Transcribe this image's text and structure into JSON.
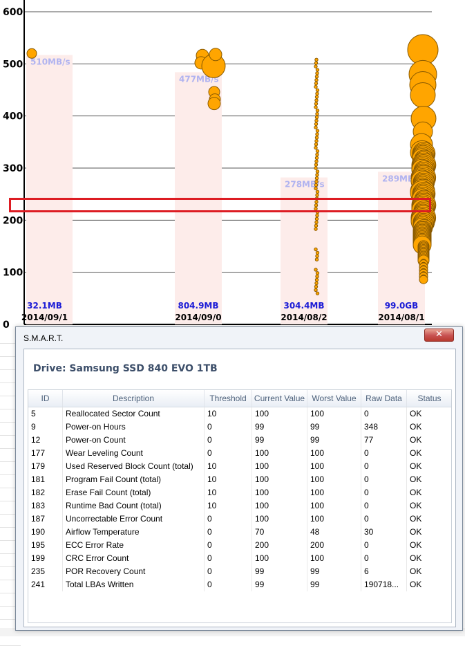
{
  "chart_data": {
    "type": "scatter",
    "y_ticks": [
      "600",
      "500",
      "400",
      "300",
      "200",
      "100",
      "0"
    ],
    "ylim": [
      0,
      600
    ],
    "grid": true,
    "columns": [
      {
        "speed_label": "510MB/s",
        "size_label": "32.1MB",
        "date_label": "2014/09/1",
        "bar_value": 517
      },
      {
        "speed_label": "477MB/s",
        "size_label": "804.9MB",
        "date_label": "2014/09/0",
        "bar_value": 484
      },
      {
        "speed_label": "278MB/s",
        "size_label": "304.4MB",
        "date_label": "2014/08/2",
        "bar_value": 282
      },
      {
        "speed_label": "289MB/s",
        "size_label": "99.0GB",
        "date_label": "2014/08/1",
        "bar_value": 293
      }
    ],
    "colors": {
      "bubble": "#FFA500",
      "bubble_stroke": "#8a5a00",
      "bar": "#fdecea",
      "speed_label": "#b0b3f0",
      "size_label": "#1b1bd6",
      "grid": "#555555"
    }
  },
  "smart": {
    "title": "S.M.A.R.T.",
    "close_symbol": "✕",
    "drive_title": "Drive: Samsung SSD 840 EVO 1TB",
    "columns": [
      "ID",
      "Description",
      "Threshold",
      "Current Value",
      "Worst Value",
      "Raw Data",
      "Status"
    ],
    "rows": [
      {
        "id": "5",
        "desc": "Reallocated Sector Count",
        "threshold": "10",
        "current": "100",
        "worst": "100",
        "raw": "0",
        "status": "OK"
      },
      {
        "id": "9",
        "desc": "Power-on Hours",
        "threshold": "0",
        "current": "99",
        "worst": "99",
        "raw": "348",
        "status": "OK"
      },
      {
        "id": "12",
        "desc": "Power-on Count",
        "threshold": "0",
        "current": "99",
        "worst": "99",
        "raw": "77",
        "status": "OK"
      },
      {
        "id": "177",
        "desc": "Wear Leveling Count",
        "threshold": "0",
        "current": "100",
        "worst": "100",
        "raw": "0",
        "status": "OK"
      },
      {
        "id": "179",
        "desc": "Used Reserved Block Count (total)",
        "threshold": "10",
        "current": "100",
        "worst": "100",
        "raw": "0",
        "status": "OK"
      },
      {
        "id": "181",
        "desc": "Program Fail Count (total)",
        "threshold": "10",
        "current": "100",
        "worst": "100",
        "raw": "0",
        "status": "OK"
      },
      {
        "id": "182",
        "desc": "Erase Fail Count (total)",
        "threshold": "10",
        "current": "100",
        "worst": "100",
        "raw": "0",
        "status": "OK"
      },
      {
        "id": "183",
        "desc": "Runtime Bad Count (total)",
        "threshold": "10",
        "current": "100",
        "worst": "100",
        "raw": "0",
        "status": "OK"
      },
      {
        "id": "187",
        "desc": "Uncorrectable Error Count",
        "threshold": "0",
        "current": "100",
        "worst": "100",
        "raw": "0",
        "status": "OK"
      },
      {
        "id": "190",
        "desc": "Airflow Temperature",
        "threshold": "0",
        "current": "70",
        "worst": "48",
        "raw": "30",
        "status": "OK"
      },
      {
        "id": "195",
        "desc": "ECC Error Rate",
        "threshold": "0",
        "current": "200",
        "worst": "200",
        "raw": "0",
        "status": "OK"
      },
      {
        "id": "199",
        "desc": "CRC Error Count",
        "threshold": "0",
        "current": "100",
        "worst": "100",
        "raw": "0",
        "status": "OK"
      },
      {
        "id": "235",
        "desc": "POR Recovery Count",
        "threshold": "0",
        "current": "99",
        "worst": "99",
        "raw": "6",
        "status": "OK"
      },
      {
        "id": "241",
        "desc": "Total LBAs Written",
        "threshold": "0",
        "current": "99",
        "worst": "99",
        "raw": "190718...",
        "status": "OK"
      }
    ],
    "highlight_color": "#dd1c23"
  }
}
